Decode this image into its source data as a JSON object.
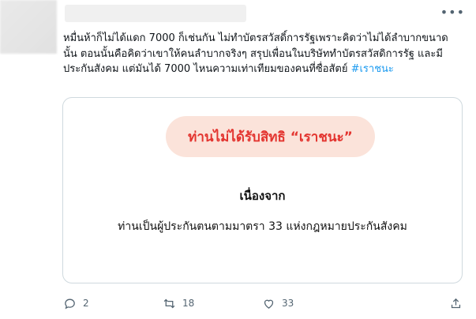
{
  "tweet": {
    "text": "หมื่นห้าก็ไม่ได้แดก 7000 ก็เช่นกัน ไม่ทำบัตรสวัสดิ์การรัฐเพราะคิดว่าไม่ได้ลำบากขนาดนั้น ตอนนั้นคือคิดว่าเขาให้คนลำบากจริงๆ สรุปเพื่อนในบริษัททำบัตรสวัสดิการรัฐ และมีประกันสังคม แต่มันได้ 7000 ไหนความเท่าเทียมของคนที่ซื่อสัตย์",
    "hashtag": "#เราชนะ"
  },
  "card": {
    "pill_text": "ท่านไม่ได้รับสิทธิ “เราชนะ”",
    "reason_heading": "เนื่องจาก",
    "reason_body": "ท่านเป็นผู้ประกันตนตามมาตรา 33 แห่งกฎหมายประกันสังคม"
  },
  "actions": {
    "reply_count": "2",
    "retweet_count": "18",
    "like_count": "33"
  },
  "colors": {
    "hashtag": "#1d9bf0",
    "pill_bg": "#fbe3da",
    "pill_text": "#e3342f",
    "icon_gray": "#536471"
  },
  "icons": [
    "more-icon",
    "reply-icon",
    "retweet-icon",
    "like-icon",
    "share-icon"
  ]
}
